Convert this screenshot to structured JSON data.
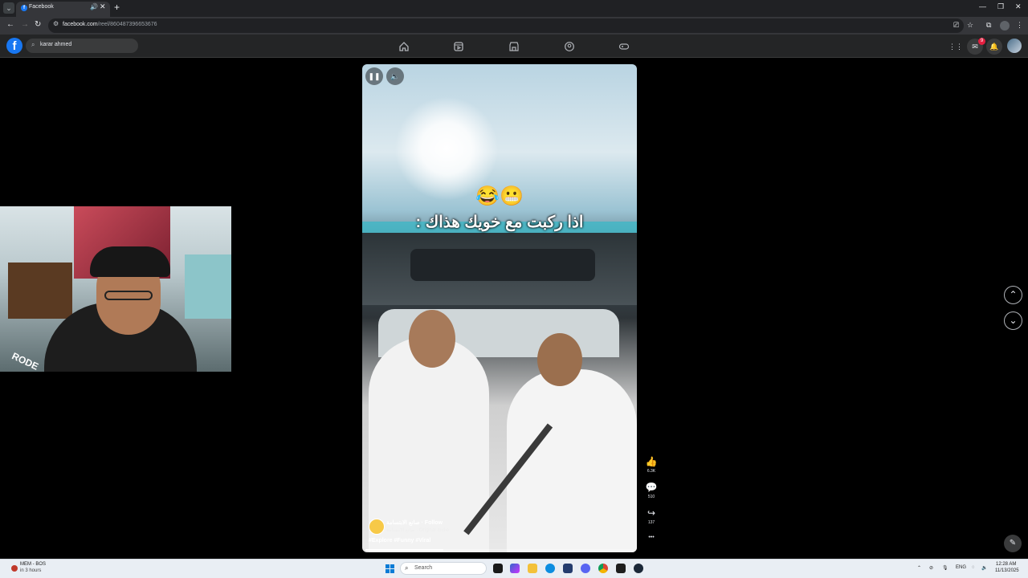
{
  "browser": {
    "tab_title": "Facebook",
    "tab_favicon_letter": "f",
    "url_host": "facebook.com",
    "url_path": "/reel/860487396653676"
  },
  "fb_nav": {
    "logo_letter": "f",
    "search_value": "karar ahmed",
    "nav_icons": [
      "home-icon",
      "reels-icon",
      "marketplace-icon",
      "groups-icon",
      "gaming-icon"
    ],
    "notification_count": "9"
  },
  "reel": {
    "emoji": "😂😬",
    "caption": "اذا ركبت مع خويك هذاك :",
    "author_name": "صانع الابتسامة",
    "follow_label": "· Follow",
    "audio_label": "صانع الابتسامة · Original audio",
    "hashtags": "#Explore #Funny #Viral",
    "progress": 0.29,
    "likes": "6.3K",
    "comments": "510",
    "shares": "137",
    "more_label": "•••"
  },
  "webcam": {
    "mic_brand": "RODE"
  },
  "taskbar": {
    "weather_line1": "MEM - BOS",
    "weather_line2": "in 3 hours",
    "search_placeholder": "Search",
    "language": "ENG",
    "time": "12:28 AM",
    "date": "11/13/2025"
  }
}
